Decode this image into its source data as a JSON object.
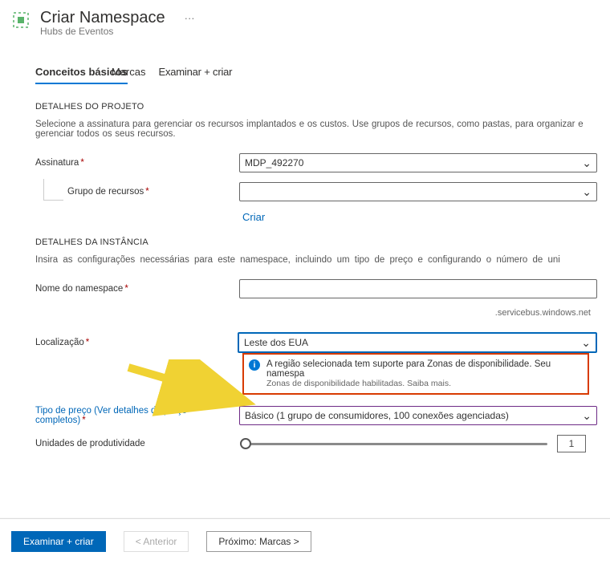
{
  "header": {
    "title": "Criar Namespace",
    "subtitle": "Hubs de Eventos",
    "more": "···"
  },
  "tabs": {
    "t1": "Conceitos básicos",
    "t2": "Marcas",
    "t3": "Examinar + criar"
  },
  "project": {
    "heading": "DETALHES DO PROJETO",
    "desc": "Selecione a assinatura para gerenciar os recursos implantados e os custos. Use grupos de recursos, como pastas, para organizar e gerenciar todos os seus recursos."
  },
  "subscription_label": "Assinatura",
  "subscription_value": "MDP_492270",
  "rg_label": "Grupo de recursos",
  "rg_value": "",
  "rg_create": "Criar",
  "instance": {
    "heading": "DETALHES DA INSTÂNCIA",
    "desc": "Insira as configurações necessárias para este namespace, incluindo um tipo de preço e configurando o número de uni"
  },
  "ns_label": "Nome do namespace",
  "ns_value": "",
  "ns_suffix": ".servicebus.windows.net",
  "loc_label": "Localização",
  "loc_value": "Leste dos EUA",
  "info_title": "A região selecionada tem suporte para Zonas de disponibilidade. Seu namespa",
  "info_sub": "Zonas de disponibilidade habilitadas. Saiba mais.",
  "price_label": "Tipo de preço (Ver detalhes de preço completos)",
  "price_value": "Básico (1 grupo de consumidores, 100 conexões agenciadas)",
  "units_label": "Unidades de produtividade",
  "units_value": "1",
  "footer": {
    "review": "Examinar + criar",
    "prev": "<  Anterior",
    "next": "Próximo: Marcas >"
  }
}
